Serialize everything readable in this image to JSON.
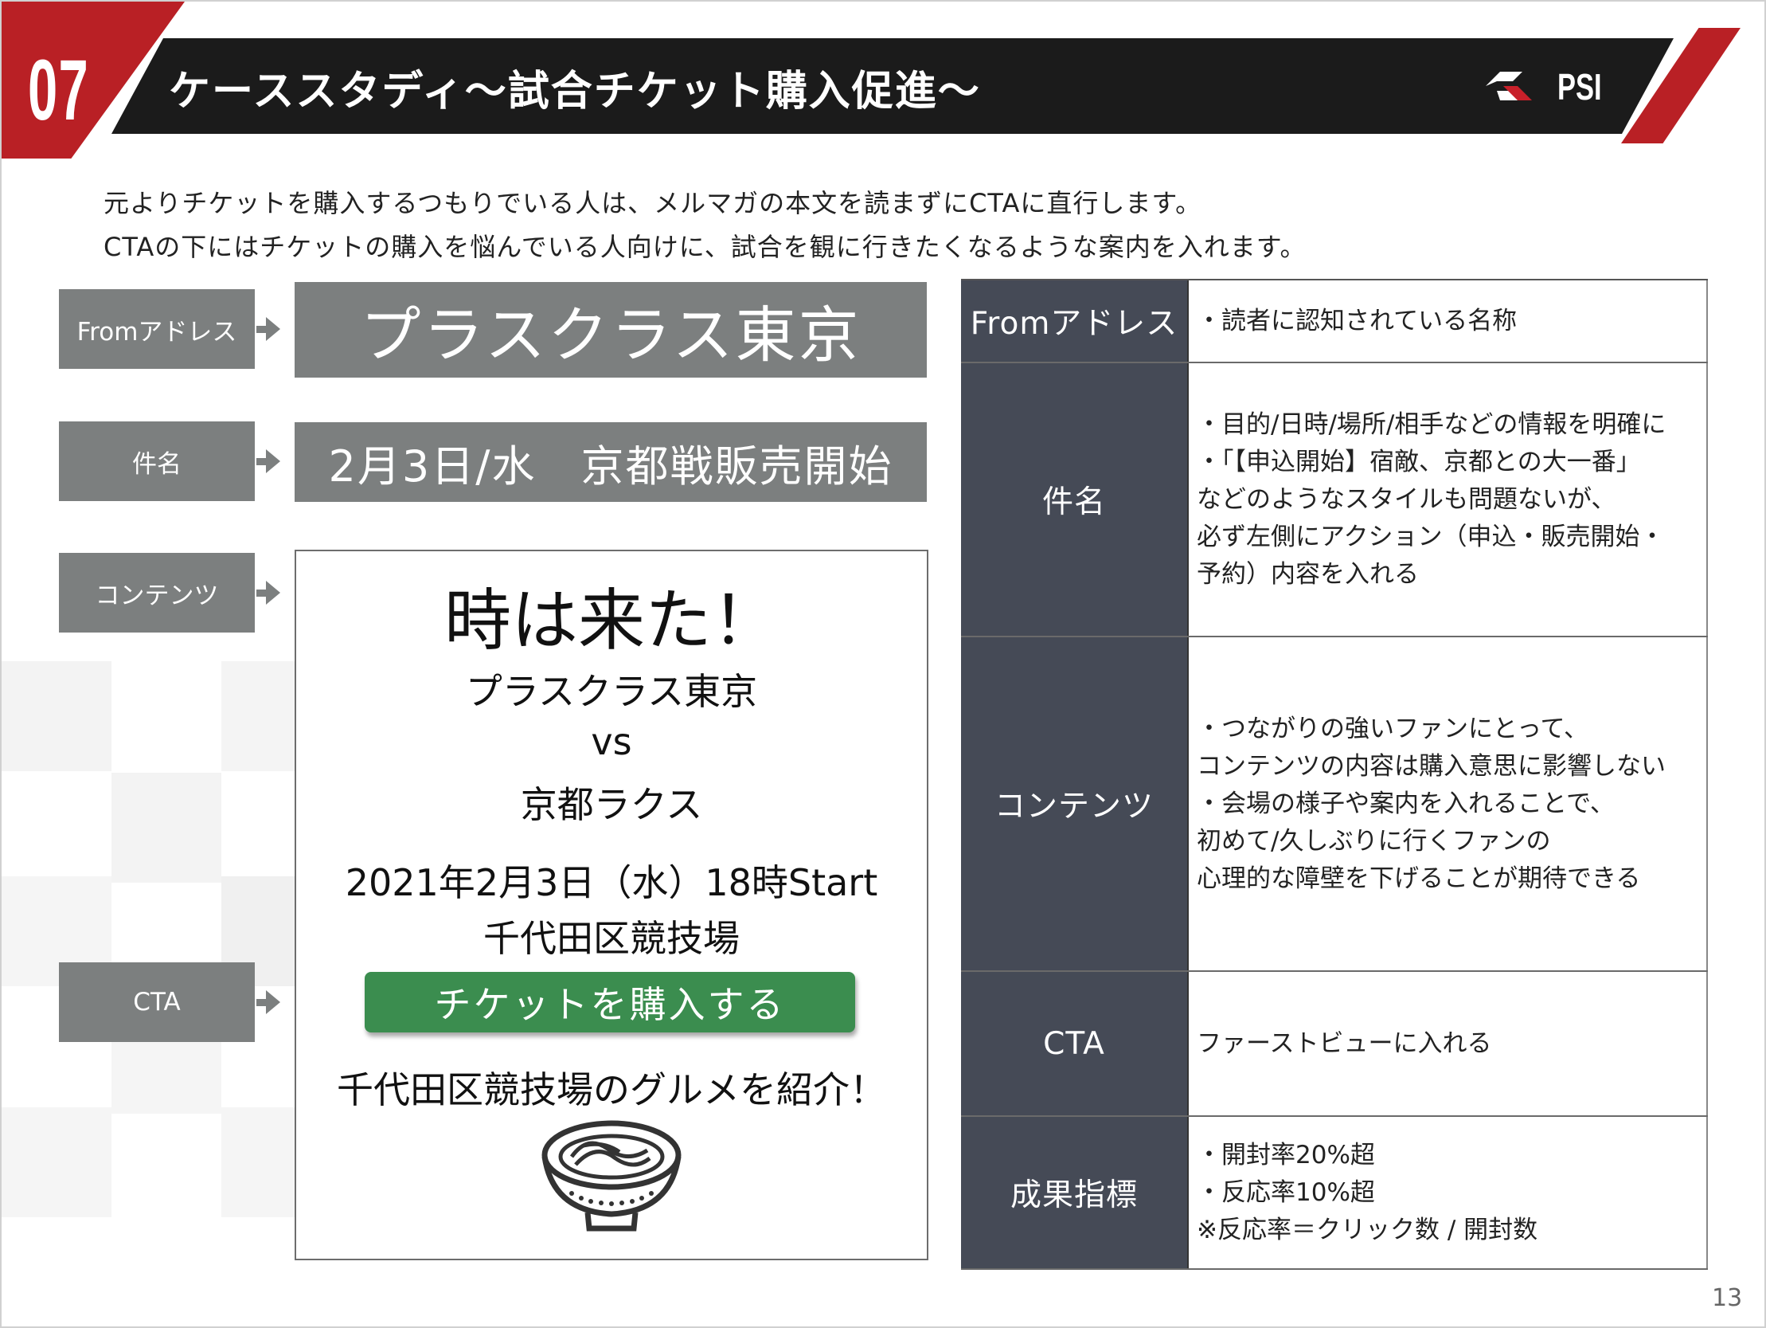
{
  "header": {
    "section_number": "07",
    "title": "ケーススタディ〜試合チケット購入促進〜",
    "logo_text": "PSI"
  },
  "intro": [
    "元よりチケットを購入するつもりでいる人は、メルマガの本文を読まずにCTAに直行します。",
    "CTAの下にはチケットの購入を悩んでいる人向けに、試合を観に行きたくなるような案内を入れます。"
  ],
  "labels": {
    "from": "Fromアドレス",
    "subject": "件名",
    "contents": "コンテンツ",
    "cta": "CTA"
  },
  "mock": {
    "from_value": "プラスクラス東京",
    "subject_value": "2月3日/水　京都戦販売開始",
    "headline": "時は来た！",
    "team_home": "プラスクラス東京",
    "vs": "vs",
    "team_away": "京都ラクス",
    "datetime": "2021年2月3日（水）18時Start",
    "venue": "千代田区競技場",
    "cta_button": "チケットを購入する",
    "gourmet": "千代田区競技場のグルメを紹介！"
  },
  "table": {
    "rows": [
      {
        "head": "Fromアドレス",
        "lines": [
          "・読者に認知されている名称"
        ]
      },
      {
        "head": "件名",
        "lines": [
          "・目的/日時/場所/相手などの情報を明確に",
          "・「【申込開始】宿敵、京都との大一番」",
          "などのようなスタイルも問題ないが、",
          "必ず左側にアクション（申込・販売開始・",
          "予約）内容を入れる"
        ]
      },
      {
        "head": "コンテンツ",
        "lines": [
          "・つながりの強いファンにとって、",
          "コンテンツの内容は購入意思に影響しない",
          "・会場の様子や案内を入れることで、",
          "初めて/久しぶりに行くファンの",
          "心理的な障壁を下げることが期待できる"
        ]
      },
      {
        "head": "CTA",
        "lines": [
          "ファーストビューに入れる"
        ]
      },
      {
        "head": "成果指標",
        "lines": [
          "・開封率20%超",
          "・反応率10%超",
          "※反応率＝クリック数 / 開封数"
        ]
      }
    ]
  },
  "page_number": "13",
  "colors": {
    "brand_red": "#b92025",
    "header_black": "#1b1b1b",
    "label_gray": "#7c7f7f",
    "table_head": "#454a56",
    "cta_green": "#3b8d4f"
  }
}
